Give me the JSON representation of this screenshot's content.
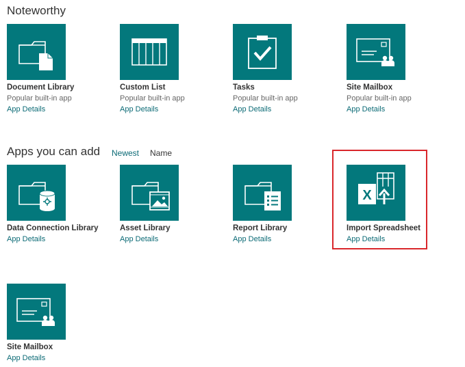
{
  "noteworthy": {
    "title": "Noteworthy",
    "apps": [
      {
        "name": "Document Library",
        "subtitle": "Popular built-in app",
        "details": "App Details",
        "icon": "document-library-icon"
      },
      {
        "name": "Custom List",
        "subtitle": "Popular built-in app",
        "details": "App Details",
        "icon": "custom-list-icon"
      },
      {
        "name": "Tasks",
        "subtitle": "Popular built-in app",
        "details": "App Details",
        "icon": "tasks-icon"
      },
      {
        "name": "Site Mailbox",
        "subtitle": "Popular built-in app",
        "details": "App Details",
        "icon": "site-mailbox-icon"
      }
    ]
  },
  "apps_you_can_add": {
    "title": "Apps you can add",
    "sort_newest": "Newest",
    "sort_name": "Name",
    "apps": [
      {
        "name": "Data Connection Library",
        "details": "App Details",
        "icon": "data-connection-library-icon"
      },
      {
        "name": "Asset Library",
        "details": "App Details",
        "icon": "asset-library-icon"
      },
      {
        "name": "Report Library",
        "details": "App Details",
        "icon": "report-library-icon"
      },
      {
        "name": "Import Spreadsheet",
        "details": "App Details",
        "icon": "import-spreadsheet-icon"
      },
      {
        "name": "Site Mailbox",
        "details": "App Details",
        "icon": "site-mailbox-icon"
      }
    ]
  },
  "colors": {
    "tile_background": "#03787c",
    "link": "#0b6a75",
    "highlight": "#d9262a"
  }
}
